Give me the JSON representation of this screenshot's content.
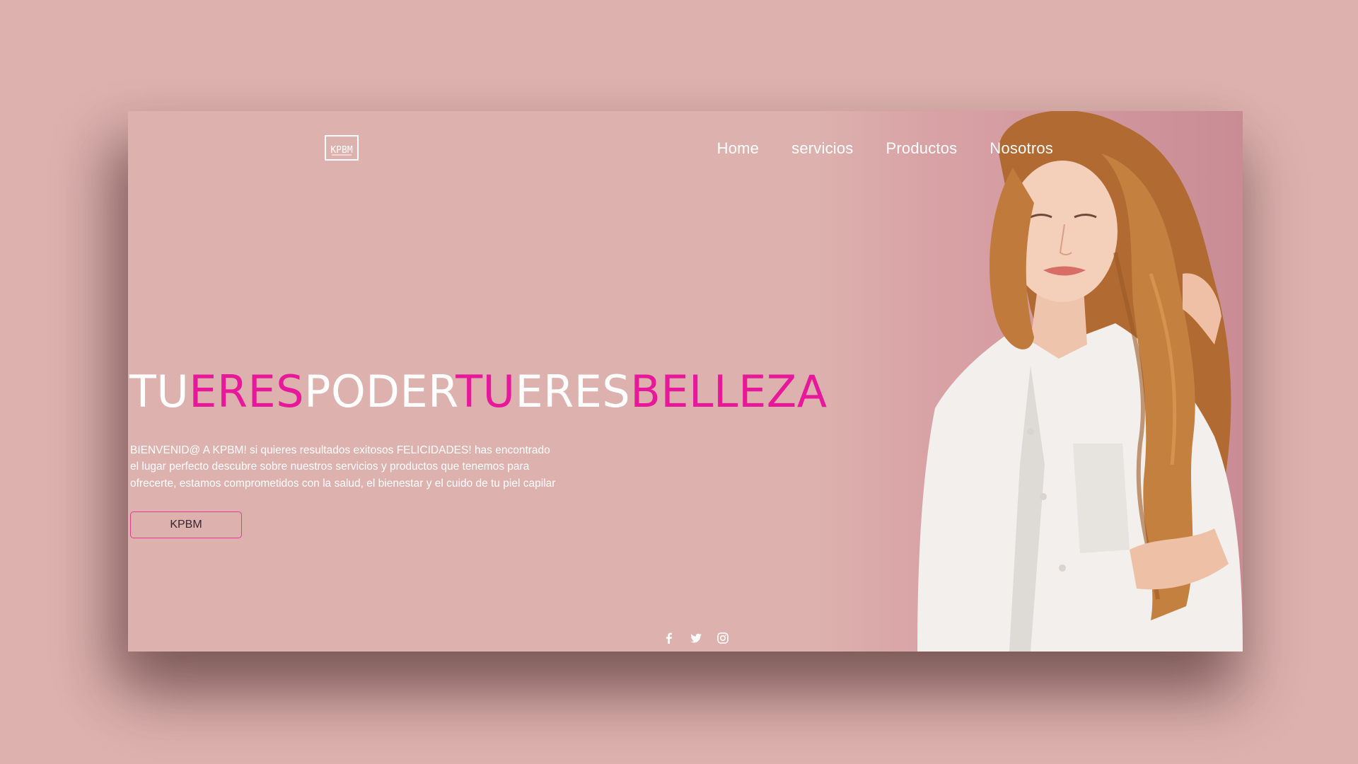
{
  "brand": {
    "logo_text": "KPBM"
  },
  "nav": {
    "items": [
      "Home",
      "servicios",
      "Productos",
      "Nosotros"
    ]
  },
  "hero": {
    "headline_parts": [
      {
        "text": "TU",
        "color": "white"
      },
      {
        "text": "ERES",
        "color": "pink"
      },
      {
        "text": "PODER",
        "color": "white"
      },
      {
        "text": "TU",
        "color": "pink"
      },
      {
        "text": "ERES",
        "color": "white"
      },
      {
        "text": "BELLEZA",
        "color": "pink"
      }
    ],
    "intro": "BIENVENID@ A KPBM! si quieres resultados exitosos FELICIDADES! has encontrado el lugar perfecto descubre sobre nuestros servicios y productos que tenemos para ofrecerte, estamos comprometidos con la salud, el bienestar y el cuido de tu piel capilar",
    "cta_label": "KPBM"
  },
  "social": {
    "icons": [
      "facebook-icon",
      "twitter-icon",
      "instagram-icon"
    ]
  },
  "colors": {
    "background": "#dcb1ae",
    "accent_pink": "#e8189a",
    "text_white": "#ffffff"
  }
}
